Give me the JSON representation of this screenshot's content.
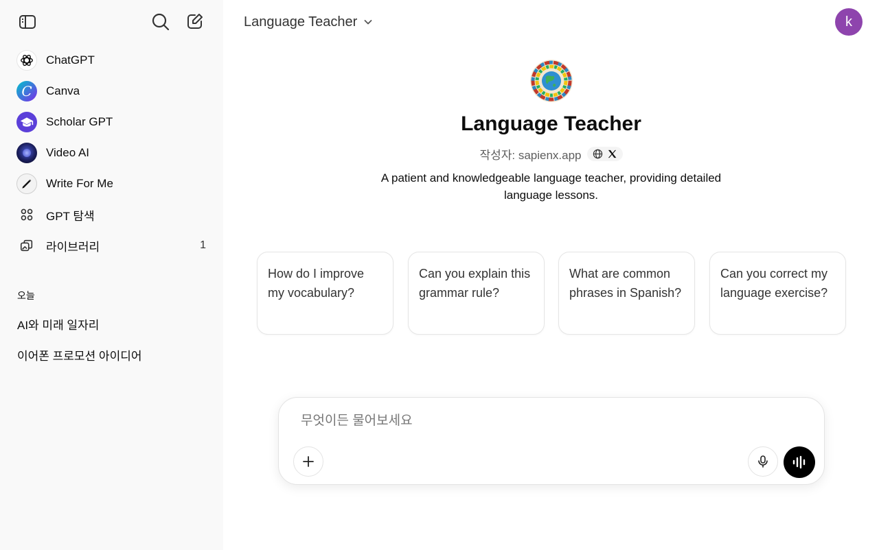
{
  "sidebar": {
    "items": [
      {
        "label": "ChatGPT",
        "icon": "chatgpt-logo-icon"
      },
      {
        "label": "Canva",
        "icon": "canva-logo-icon"
      },
      {
        "label": "Scholar GPT",
        "icon": "scholar-cap-icon"
      },
      {
        "label": "Video AI",
        "icon": "video-ai-icon"
      },
      {
        "label": "Write For Me",
        "icon": "pen-icon"
      },
      {
        "label": "GPT 탐색",
        "icon": "grid-icon"
      },
      {
        "label": "라이브러리",
        "icon": "library-icon",
        "count": "1"
      }
    ],
    "section_today": "오늘",
    "history": [
      "AI와 미래 일자리",
      "이어폰 프로모션 아이디어"
    ]
  },
  "header": {
    "model_name": "Language Teacher",
    "avatar_letter": "k"
  },
  "gpt": {
    "title": "Language Teacher",
    "byline": "작성자: sapienx.app",
    "description": "A patient and knowledgeable language teacher, providing detailed language lessons."
  },
  "suggestions": [
    "How do I improve my vocabulary?",
    "Can you explain this grammar rule?",
    "What are common phrases in Spanish?",
    "Can you correct my language exercise?"
  ],
  "composer": {
    "placeholder": "무엇이든 물어보세요"
  },
  "colors": {
    "sidebar_bg": "#f9f9f9",
    "avatar_bg": "#8e44ad",
    "accent": "#000000"
  }
}
